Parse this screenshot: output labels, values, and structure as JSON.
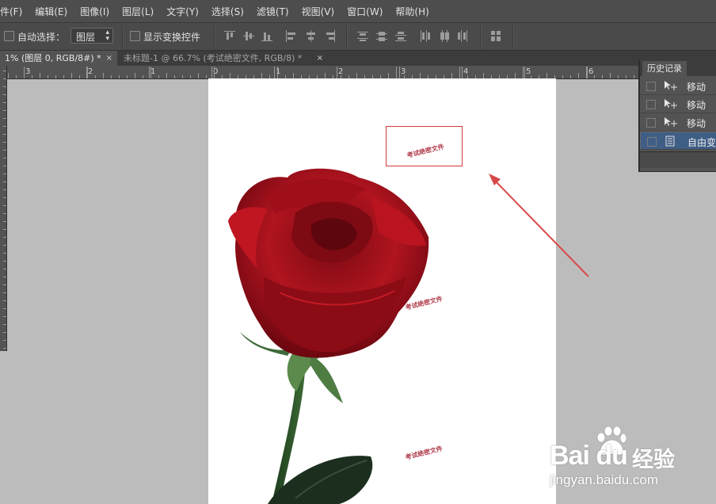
{
  "menu": [
    "件(F)",
    "编辑(E)",
    "图像(I)",
    "图层(L)",
    "文字(Y)",
    "选择(S)",
    "滤镜(T)",
    "视图(V)",
    "窗口(W)",
    "帮助(H)"
  ],
  "options": {
    "auto_select_label": "自动选择：",
    "auto_select_value": "图层",
    "show_transform_label": "显示变换控件"
  },
  "tabs": [
    {
      "label": "1% (图层 0, RGB/8#) *",
      "close": "×"
    },
    {
      "label": "未标题-1 @ 66.7% (考试绝密文件, RGB/8) *",
      "close": "×"
    }
  ],
  "ruler_h_labels": [
    "3",
    "2",
    "1",
    "0",
    "1",
    "2",
    "3",
    "4",
    "5",
    "6"
  ],
  "canvas": {
    "watermark_text": "考试绝密文件"
  },
  "history_panel": {
    "title": "历史记录",
    "items": [
      {
        "label": "移动",
        "icon": "move-tool-icon",
        "selected": false
      },
      {
        "label": "移动",
        "icon": "move-tool-icon",
        "selected": false
      },
      {
        "label": "移动",
        "icon": "move-tool-icon",
        "selected": false
      },
      {
        "label": "自由变",
        "icon": "document-icon",
        "selected": true
      }
    ]
  },
  "brand": {
    "logo_text": "Bai du",
    "logo_cn": "经验",
    "url": "jingyan.baidu.com"
  },
  "colors": {
    "annotation_red": "#d33a3a",
    "history_selected": "#3f5e86",
    "rose_red": "#a5101a"
  }
}
